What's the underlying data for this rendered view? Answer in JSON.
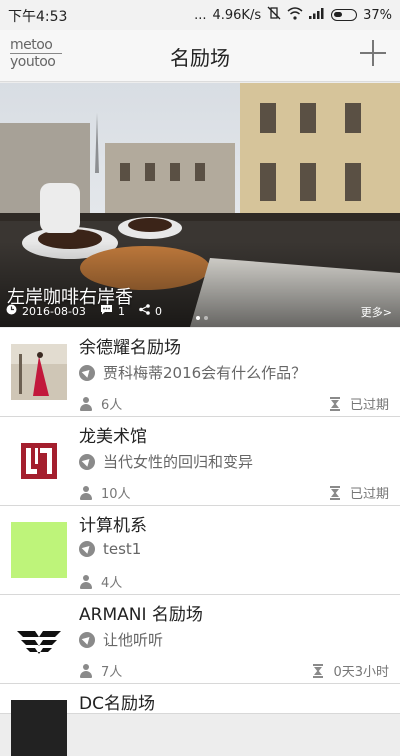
{
  "status_bar": {
    "time": "下午4:53",
    "dots": "...",
    "speed": "4.96K/s",
    "battery": "37%"
  },
  "header": {
    "logo_line1": "metoo",
    "logo_line2": "youtoo",
    "title": "名励场",
    "add_icon": "plus-icon"
  },
  "banner": {
    "title": "左岸咖啡右岸香",
    "date": "2016-08-03",
    "comments": "1",
    "shares": "0",
    "more": "更多>"
  },
  "items": [
    {
      "name": "余德耀名励场",
      "topic": "贾科梅蒂2016会有什么作品？",
      "members": "6人",
      "status": "已过期"
    },
    {
      "name": "龙美术馆",
      "topic": "当代女性的回归和变异",
      "members": "10人",
      "status": "已过期"
    },
    {
      "name": "计算机系",
      "topic": "test1",
      "members": "4人",
      "status": ""
    },
    {
      "name": "ARMANI 名励场",
      "topic": "让他听听",
      "members": "7人",
      "status": "0天3小时"
    },
    {
      "name": "DC名励场",
      "topic": "",
      "members": "",
      "status": ""
    }
  ],
  "colors": {
    "header_bg": "#f7f7f7",
    "long_museum_red": "#a41f2e",
    "green_thumb": "#b5f26a"
  }
}
